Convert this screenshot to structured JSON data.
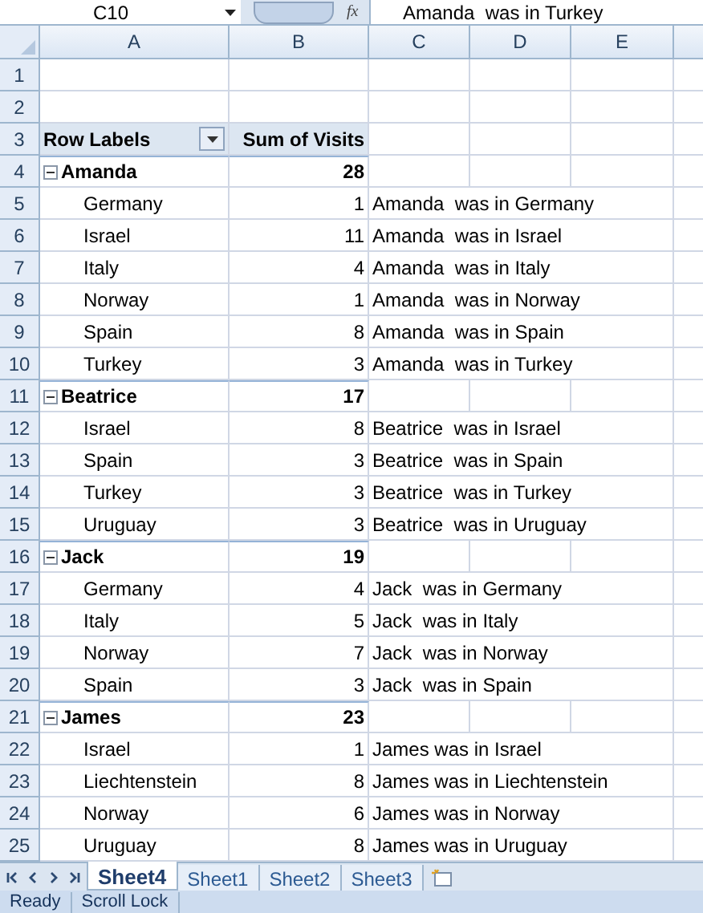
{
  "formula_bar": {
    "name_box": "C10",
    "function_label": "fx",
    "formula": "Amanda  was in Turkey"
  },
  "columns": [
    "A",
    "B",
    "C",
    "D",
    "E"
  ],
  "rows": [
    {
      "number": "1",
      "kind": "blank"
    },
    {
      "number": "2",
      "kind": "blank"
    },
    {
      "number": "3",
      "kind": "header",
      "label": "Row Labels",
      "value": "Sum of Visits"
    },
    {
      "number": "4",
      "kind": "group",
      "label": "Amanda",
      "value": "28",
      "expanded": true
    },
    {
      "number": "5",
      "kind": "item",
      "label": "Germany",
      "value": "1",
      "note": "Amanda  was in Germany"
    },
    {
      "number": "6",
      "kind": "item",
      "label": "Israel",
      "value": "11",
      "note": "Amanda  was in Israel"
    },
    {
      "number": "7",
      "kind": "item",
      "label": "Italy",
      "value": "4",
      "note": "Amanda  was in Italy"
    },
    {
      "number": "8",
      "kind": "item",
      "label": "Norway",
      "value": "1",
      "note": "Amanda  was in Norway"
    },
    {
      "number": "9",
      "kind": "item",
      "label": "Spain",
      "value": "8",
      "note": "Amanda  was in Spain"
    },
    {
      "number": "10",
      "kind": "item",
      "label": "Turkey",
      "value": "3",
      "note": "Amanda  was in Turkey"
    },
    {
      "number": "11",
      "kind": "group",
      "label": "Beatrice",
      "value": "17",
      "expanded": true
    },
    {
      "number": "12",
      "kind": "item",
      "label": "Israel",
      "value": "8",
      "note": "Beatrice  was in Israel"
    },
    {
      "number": "13",
      "kind": "item",
      "label": "Spain",
      "value": "3",
      "note": "Beatrice  was in Spain"
    },
    {
      "number": "14",
      "kind": "item",
      "label": "Turkey",
      "value": "3",
      "note": "Beatrice  was in Turkey"
    },
    {
      "number": "15",
      "kind": "item",
      "label": "Uruguay",
      "value": "3",
      "note": "Beatrice  was in Uruguay"
    },
    {
      "number": "16",
      "kind": "group",
      "label": "Jack",
      "value": "19",
      "expanded": true
    },
    {
      "number": "17",
      "kind": "item",
      "label": "Germany",
      "value": "4",
      "note": "Jack  was in Germany"
    },
    {
      "number": "18",
      "kind": "item",
      "label": "Italy",
      "value": "5",
      "note": "Jack  was in Italy"
    },
    {
      "number": "19",
      "kind": "item",
      "label": "Norway",
      "value": "7",
      "note": "Jack  was in Norway"
    },
    {
      "number": "20",
      "kind": "item",
      "label": "Spain",
      "value": "3",
      "note": "Jack  was in Spain"
    },
    {
      "number": "21",
      "kind": "group",
      "label": "James",
      "value": "23",
      "expanded": true
    },
    {
      "number": "22",
      "kind": "item",
      "label": "Israel",
      "value": "1",
      "note": "James was in Israel"
    },
    {
      "number": "23",
      "kind": "item",
      "label": "Liechtenstein",
      "value": "8",
      "note": "James was in Liechtenstein"
    },
    {
      "number": "24",
      "kind": "item",
      "label": "Norway",
      "value": "6",
      "note": "James was in Norway"
    },
    {
      "number": "25",
      "kind": "item",
      "label": "Uruguay",
      "value": "8",
      "note": "James was in Uruguay"
    }
  ],
  "sheet_tabs": [
    {
      "label": "Sheet4",
      "selected": true
    },
    {
      "label": "Sheet1",
      "selected": false
    },
    {
      "label": "Sheet2",
      "selected": false
    },
    {
      "label": "Sheet3",
      "selected": false
    }
  ],
  "status_bar": [
    "Ready",
    "Scroll Lock"
  ]
}
